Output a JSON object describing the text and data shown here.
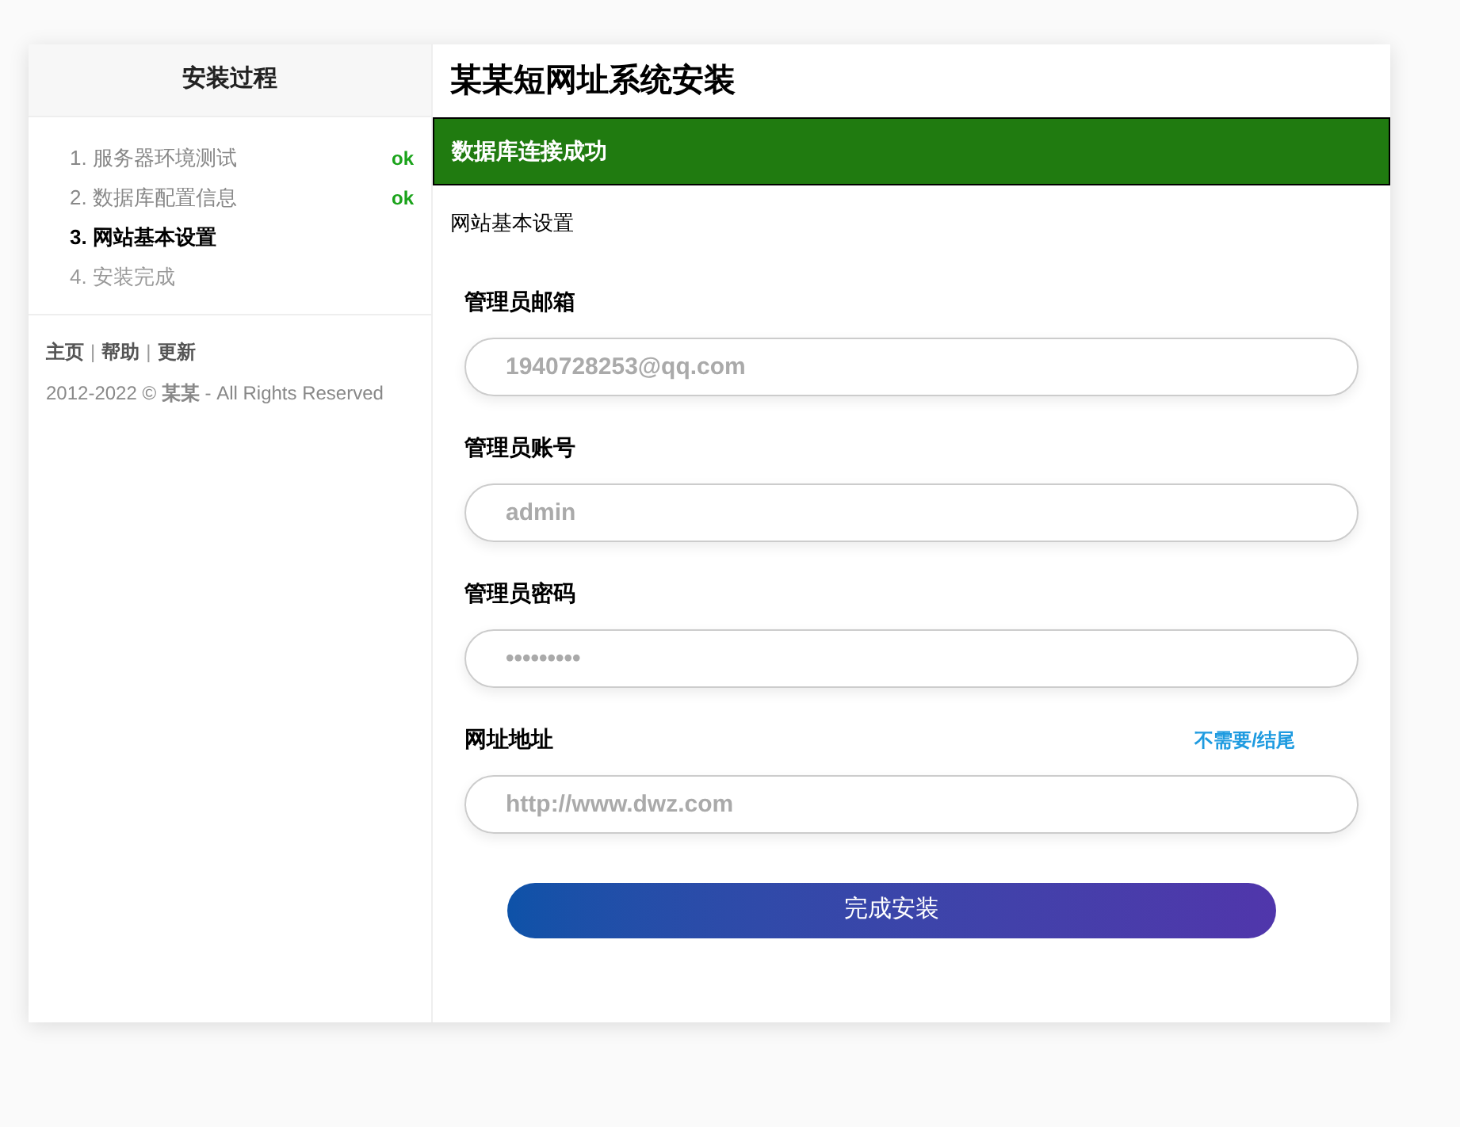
{
  "sidebar": {
    "title": "安装过程",
    "steps": [
      {
        "label": "1. 服务器环境测试",
        "kind": "done",
        "badge": "ok"
      },
      {
        "label": "2. 数据库配置信息",
        "kind": "done",
        "badge": "ok"
      },
      {
        "label": "3. 网站基本设置",
        "kind": "current"
      },
      {
        "label": "4. 安装完成",
        "kind": "pending"
      }
    ],
    "footer_links": [
      "主页",
      "帮助",
      "更新"
    ],
    "separator": "|",
    "copyright": "2012-2022 © **某某** - All Rights Reserved"
  },
  "main": {
    "title": "某某短网址系统安装",
    "alert": "数据库连接成功",
    "section": "网站基本设置",
    "fields": [
      {
        "label": "管理员邮箱",
        "placeholder": "1940728253@qq.com"
      },
      {
        "label": "管理员账号",
        "placeholder": "admin"
      },
      {
        "label": "管理员密码",
        "placeholder": "•••••••••"
      },
      {
        "label": "网址地址",
        "hint": "不需要/结尾",
        "placeholder": "http://www.dwz.com"
      }
    ],
    "submit": "完成安装"
  }
}
